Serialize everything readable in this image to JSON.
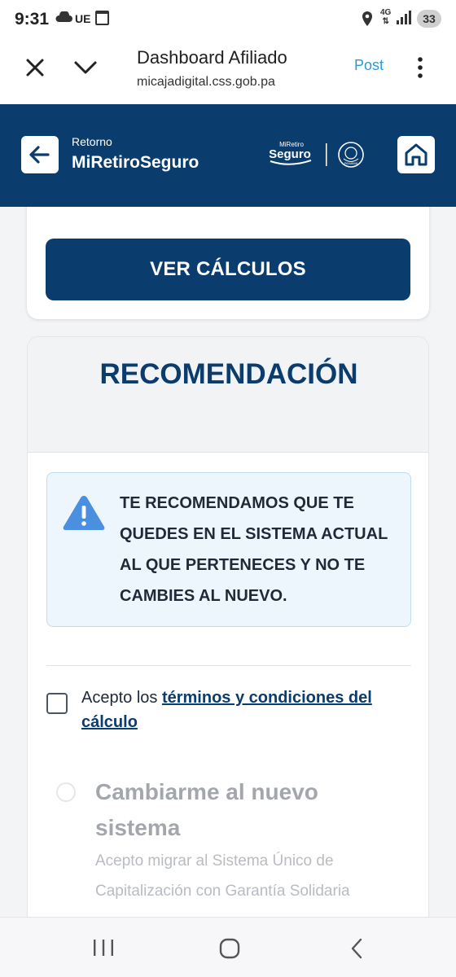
{
  "status_bar": {
    "time": "9:31",
    "carrier": "UE",
    "network": "4G",
    "battery": "33"
  },
  "browser": {
    "title": "Dashboard Afiliado",
    "url": "micajadigital.css.gob.pa",
    "post_label": "Post"
  },
  "app_header": {
    "back_small": "Retorno",
    "back_big": "MiRetiroSeguro",
    "logo_top": "MiRetiro",
    "logo_main": "Seguro",
    "seal_text": "PANAMÁ",
    "colors": {
      "primary": "#0a3c6e"
    }
  },
  "card1": {
    "button_label": "VER CÁLCULOS"
  },
  "recomendacion": {
    "title": "RECOMENDACIÓN",
    "alert_icon": "warning-triangle-icon",
    "alert_message": "TE RECOMENDAMOS QUE TE QUEDES EN EL SISTEMA ACTUAL AL QUE PERTENECES Y NO TE CAMBIES AL NUEVO.",
    "terms_prefix": "Acepto los ",
    "terms_link": "términos y condiciones del cálculo",
    "option": {
      "title": "Cambiarme al nuevo sistema",
      "description": "Acepto migrar al Sistema Único de Capitalización con Garantía Solidaria"
    }
  },
  "nav_bar": {
    "recents_icon": "recents-icon",
    "home_icon": "home-circle-icon",
    "back_icon": "back-chevron-icon"
  }
}
